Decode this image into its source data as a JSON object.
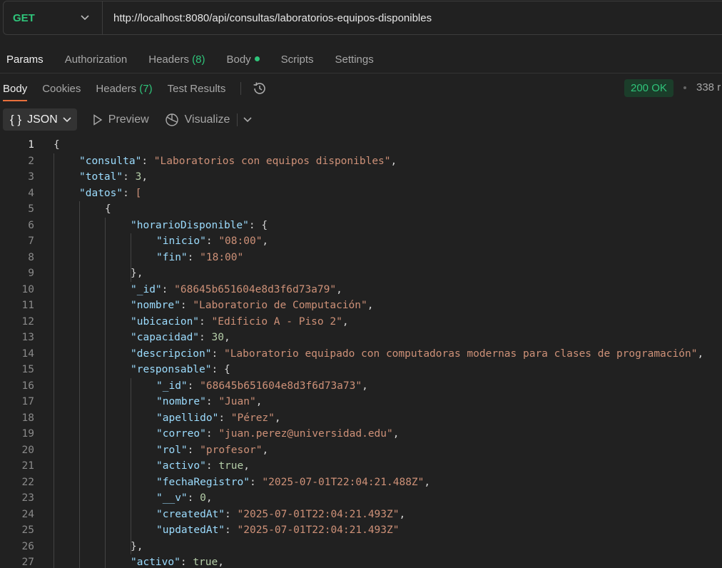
{
  "request": {
    "method": "GET",
    "url": "http://localhost:8080/api/consultas/laboratorios-equipos-disponibles"
  },
  "request_tabs": [
    {
      "label": "Params"
    },
    {
      "label": "Authorization"
    },
    {
      "label": "Headers",
      "count": "(8)"
    },
    {
      "label": "Body"
    },
    {
      "label": "Scripts"
    },
    {
      "label": "Settings"
    }
  ],
  "response_tabs": [
    {
      "label": "Body"
    },
    {
      "label": "Cookies"
    },
    {
      "label": "Headers",
      "count": "(7)"
    },
    {
      "label": "Test Results"
    }
  ],
  "response_status": {
    "code": "200 OK",
    "time": "338 r"
  },
  "format_bar": {
    "json": "JSON",
    "preview": "Preview",
    "visualize": "Visualize"
  },
  "code_lines": [
    {
      "n": "1",
      "indent": 0,
      "tokens": [
        [
          "p",
          "{"
        ]
      ]
    },
    {
      "n": "2",
      "indent": 1,
      "tokens": [
        [
          "k",
          "\"consulta\""
        ],
        [
          "p",
          ": "
        ],
        [
          "s",
          "\"Laboratorios con equipos disponibles\""
        ],
        [
          "p",
          ","
        ]
      ]
    },
    {
      "n": "3",
      "indent": 1,
      "tokens": [
        [
          "k",
          "\"total\""
        ],
        [
          "p",
          ": "
        ],
        [
          "n",
          "3"
        ],
        [
          "p",
          ","
        ]
      ]
    },
    {
      "n": "4",
      "indent": 1,
      "tokens": [
        [
          "k",
          "\"datos\""
        ],
        [
          "p",
          ": "
        ],
        [
          "b",
          "["
        ]
      ]
    },
    {
      "n": "5",
      "indent": 2,
      "tokens": [
        [
          "p",
          "{"
        ]
      ]
    },
    {
      "n": "6",
      "indent": 3,
      "tokens": [
        [
          "k",
          "\"horarioDisponible\""
        ],
        [
          "p",
          ": {"
        ]
      ]
    },
    {
      "n": "7",
      "indent": 4,
      "tokens": [
        [
          "k",
          "\"inicio\""
        ],
        [
          "p",
          ": "
        ],
        [
          "s",
          "\"08:00\""
        ],
        [
          "p",
          ","
        ]
      ]
    },
    {
      "n": "8",
      "indent": 4,
      "tokens": [
        [
          "k",
          "\"fin\""
        ],
        [
          "p",
          ": "
        ],
        [
          "s",
          "\"18:00\""
        ]
      ]
    },
    {
      "n": "9",
      "indent": 3,
      "tokens": [
        [
          "p",
          "},"
        ]
      ]
    },
    {
      "n": "10",
      "indent": 3,
      "tokens": [
        [
          "k",
          "\"_id\""
        ],
        [
          "p",
          ": "
        ],
        [
          "s",
          "\"68645b651604e8d3f6d73a79\""
        ],
        [
          "p",
          ","
        ]
      ]
    },
    {
      "n": "11",
      "indent": 3,
      "tokens": [
        [
          "k",
          "\"nombre\""
        ],
        [
          "p",
          ": "
        ],
        [
          "s",
          "\"Laboratorio de Computación\""
        ],
        [
          "p",
          ","
        ]
      ]
    },
    {
      "n": "12",
      "indent": 3,
      "tokens": [
        [
          "k",
          "\"ubicacion\""
        ],
        [
          "p",
          ": "
        ],
        [
          "s",
          "\"Edificio A - Piso 2\""
        ],
        [
          "p",
          ","
        ]
      ]
    },
    {
      "n": "13",
      "indent": 3,
      "tokens": [
        [
          "k",
          "\"capacidad\""
        ],
        [
          "p",
          ": "
        ],
        [
          "n",
          "30"
        ],
        [
          "p",
          ","
        ]
      ]
    },
    {
      "n": "14",
      "indent": 3,
      "tokens": [
        [
          "k",
          "\"descripcion\""
        ],
        [
          "p",
          ": "
        ],
        [
          "s",
          "\"Laboratorio equipado con computadoras modernas para clases de programación\""
        ],
        [
          "p",
          ","
        ]
      ]
    },
    {
      "n": "15",
      "indent": 3,
      "tokens": [
        [
          "k",
          "\"responsable\""
        ],
        [
          "p",
          ": {"
        ]
      ]
    },
    {
      "n": "16",
      "indent": 4,
      "tokens": [
        [
          "k",
          "\"_id\""
        ],
        [
          "p",
          ": "
        ],
        [
          "s",
          "\"68645b651604e8d3f6d73a73\""
        ],
        [
          "p",
          ","
        ]
      ]
    },
    {
      "n": "17",
      "indent": 4,
      "tokens": [
        [
          "k",
          "\"nombre\""
        ],
        [
          "p",
          ": "
        ],
        [
          "s",
          "\"Juan\""
        ],
        [
          "p",
          ","
        ]
      ]
    },
    {
      "n": "18",
      "indent": 4,
      "tokens": [
        [
          "k",
          "\"apellido\""
        ],
        [
          "p",
          ": "
        ],
        [
          "s",
          "\"Pérez\""
        ],
        [
          "p",
          ","
        ]
      ]
    },
    {
      "n": "19",
      "indent": 4,
      "tokens": [
        [
          "k",
          "\"correo\""
        ],
        [
          "p",
          ": "
        ],
        [
          "s",
          "\"juan.perez@universidad.edu\""
        ],
        [
          "p",
          ","
        ]
      ]
    },
    {
      "n": "20",
      "indent": 4,
      "tokens": [
        [
          "k",
          "\"rol\""
        ],
        [
          "p",
          ": "
        ],
        [
          "s",
          "\"profesor\""
        ],
        [
          "p",
          ","
        ]
      ]
    },
    {
      "n": "21",
      "indent": 4,
      "tokens": [
        [
          "k",
          "\"activo\""
        ],
        [
          "p",
          ": "
        ],
        [
          "n",
          "true"
        ],
        [
          "p",
          ","
        ]
      ]
    },
    {
      "n": "22",
      "indent": 4,
      "tokens": [
        [
          "k",
          "\"fechaRegistro\""
        ],
        [
          "p",
          ": "
        ],
        [
          "s",
          "\"2025-07-01T22:04:21.488Z\""
        ],
        [
          "p",
          ","
        ]
      ]
    },
    {
      "n": "23",
      "indent": 4,
      "tokens": [
        [
          "k",
          "\"__v\""
        ],
        [
          "p",
          ": "
        ],
        [
          "n",
          "0"
        ],
        [
          "p",
          ","
        ]
      ]
    },
    {
      "n": "24",
      "indent": 4,
      "tokens": [
        [
          "k",
          "\"createdAt\""
        ],
        [
          "p",
          ": "
        ],
        [
          "s",
          "\"2025-07-01T22:04:21.493Z\""
        ],
        [
          "p",
          ","
        ]
      ]
    },
    {
      "n": "25",
      "indent": 4,
      "tokens": [
        [
          "k",
          "\"updatedAt\""
        ],
        [
          "p",
          ": "
        ],
        [
          "s",
          "\"2025-07-01T22:04:21.493Z\""
        ]
      ]
    },
    {
      "n": "26",
      "indent": 3,
      "tokens": [
        [
          "p",
          "},"
        ]
      ]
    },
    {
      "n": "27",
      "indent": 3,
      "tokens": [
        [
          "k",
          "\"activo\""
        ],
        [
          "p",
          ": "
        ],
        [
          "n",
          "true"
        ],
        [
          "p",
          ","
        ]
      ]
    }
  ]
}
